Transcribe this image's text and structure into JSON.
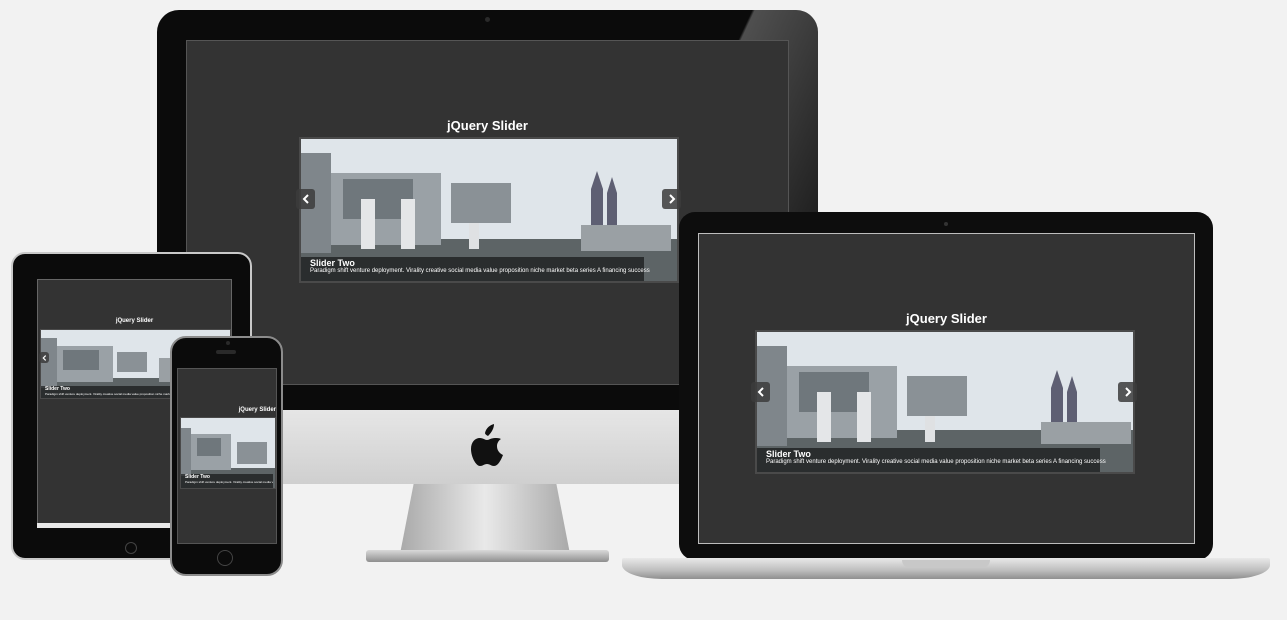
{
  "slider": {
    "title": "jQuery Slider",
    "caption_title": "Slider Two",
    "caption_text": "Paradigm shift venture deployment. Virality creative social media value proposition niche market beta series A financing success"
  },
  "icons": {
    "prev": "chevron-left-icon",
    "next": "chevron-right-icon",
    "logo": "apple-logo-icon"
  },
  "colors": {
    "page_background": "#f2f2f2",
    "screen_background": "#333333",
    "device_bezel": "#0b0b0b"
  }
}
